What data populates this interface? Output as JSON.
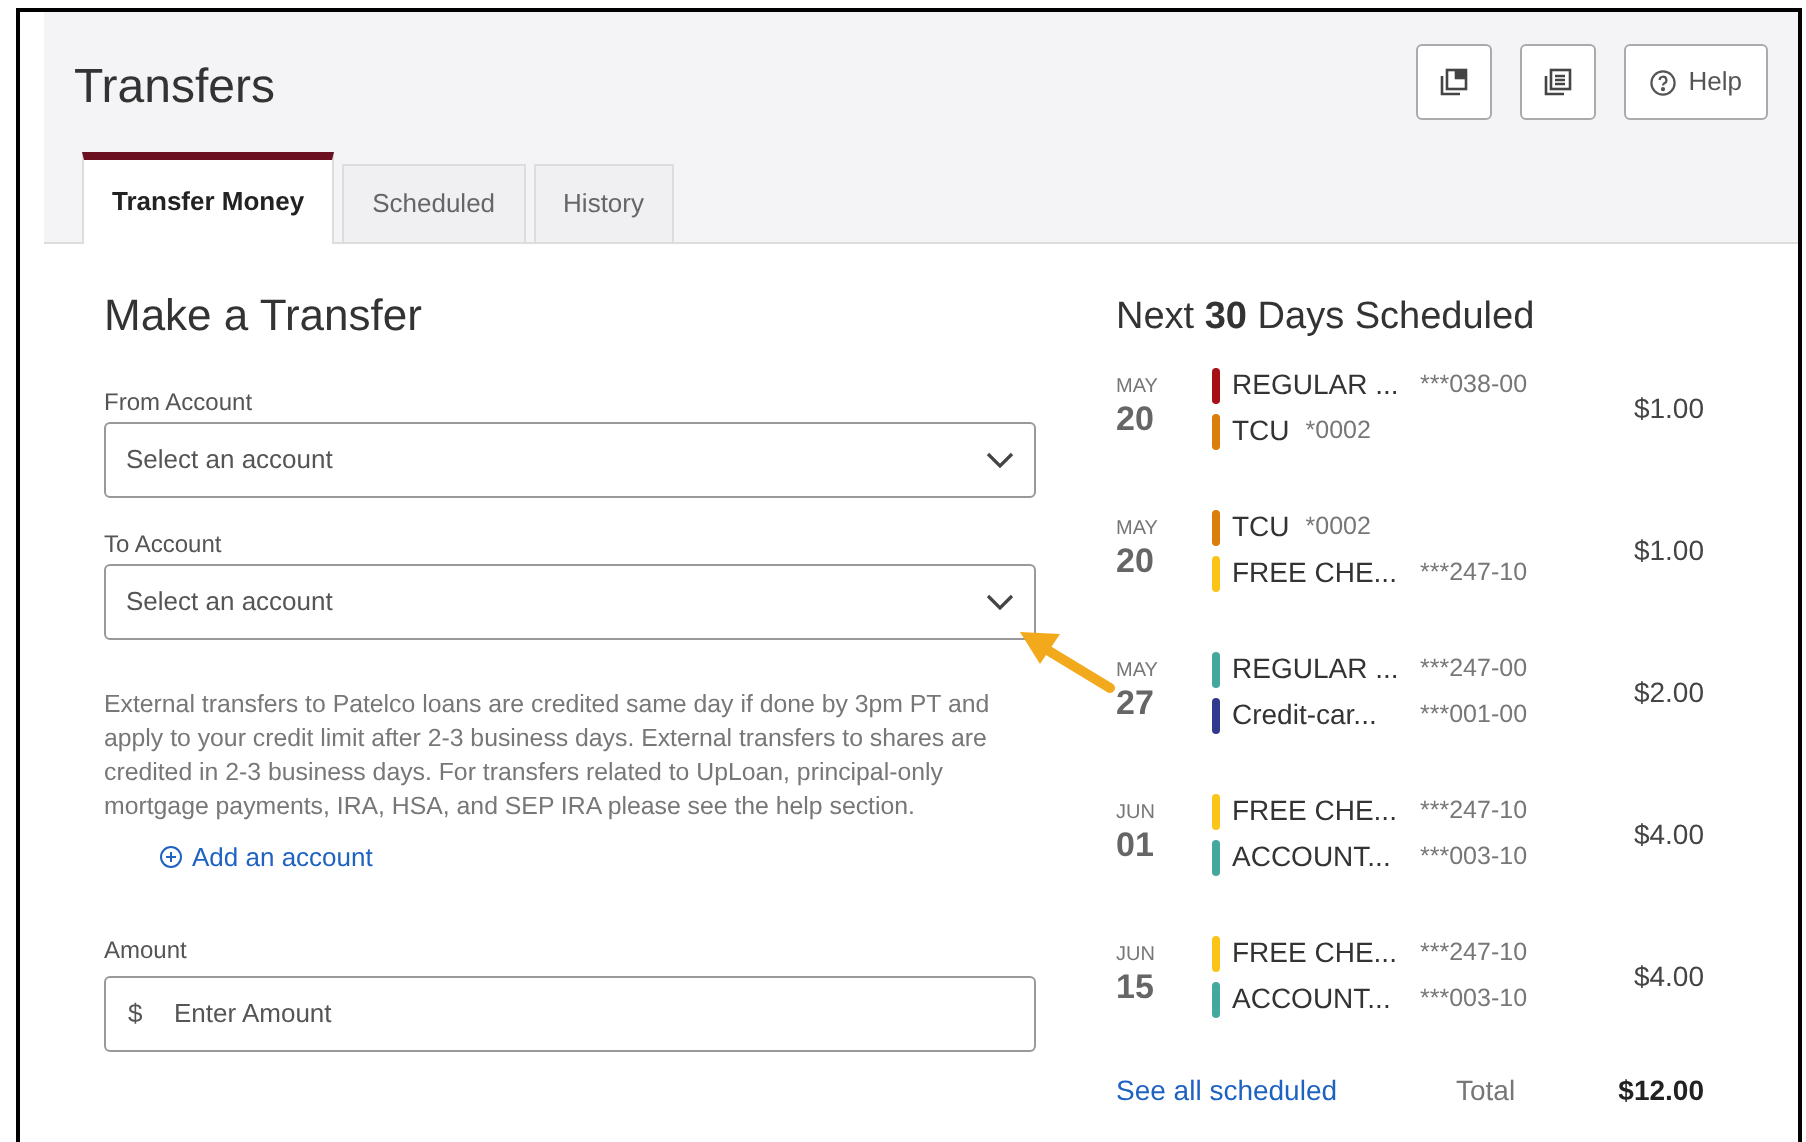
{
  "page_title": "Transfers",
  "header_buttons": [
    {
      "kind": "windows"
    },
    {
      "kind": "document"
    },
    {
      "kind": "help",
      "label": "Help"
    }
  ],
  "tabs": [
    {
      "label": "Transfer Money",
      "selected": true
    },
    {
      "label": "Scheduled",
      "selected": false
    },
    {
      "label": "History",
      "selected": false
    }
  ],
  "form": {
    "title": "Make a Transfer",
    "from_account": {
      "label": "From Account",
      "placeholder": "Select an account"
    },
    "to_account": {
      "label": "To Account",
      "placeholder": "Select an account"
    },
    "notice": "External transfers to Patelco loans are credited same day if done by 3pm PT and apply to your credit limit after 2-3 business days. External transfers to shares are credited in 2-3 business days. For transfers related to UpLoan, principal-only mortgage payments, IRA, HSA, and SEP IRA please see the help section.",
    "add_account_link": "Add an account",
    "amount": {
      "label": "Amount",
      "prefix": "$",
      "placeholder": "Enter Amount"
    }
  },
  "scheduled": {
    "title": "Next **30** Days Scheduled",
    "items": [
      {
        "month": "MAY",
        "day": "20",
        "amount": "$1.00",
        "accounts": [
          {
            "name": "REGULAR ...",
            "number": "***038-00",
            "color": "#a50f15"
          },
          {
            "name": "TCU",
            "number": "*0002",
            "color": "#d97f0a"
          }
        ]
      },
      {
        "month": "MAY",
        "day": "20",
        "amount": "$1.00",
        "accounts": [
          {
            "name": "TCU",
            "number": "*0002",
            "color": "#d97f0a"
          },
          {
            "name": "FREE CHE...",
            "number": "***247-10",
            "color": "#fcc419"
          }
        ]
      },
      {
        "month": "MAY",
        "day": "27",
        "amount": "$2.00",
        "accounts": [
          {
            "name": "REGULAR ...",
            "number": "***247-00",
            "color": "#45a89e"
          },
          {
            "name": "Credit-car...",
            "number": "***001-00",
            "color": "#2f3a8f"
          }
        ]
      },
      {
        "month": "JUN",
        "day": "01",
        "amount": "$4.00",
        "accounts": [
          {
            "name": "FREE CHE...",
            "number": "***247-10",
            "color": "#fcc419"
          },
          {
            "name": "ACCOUNT...",
            "number": "***003-10",
            "color": "#45a89e"
          }
        ]
      },
      {
        "month": "JUN",
        "day": "15",
        "amount": "$4.00",
        "accounts": [
          {
            "name": "FREE CHE...",
            "number": "***247-10",
            "color": "#fcc419"
          },
          {
            "name": "ACCOUNT...",
            "number": "***003-10",
            "color": "#45a89e"
          }
        ]
      }
    ],
    "see_all_link": "See all scheduled",
    "total_label": "Total",
    "total_value": "$12.00"
  }
}
